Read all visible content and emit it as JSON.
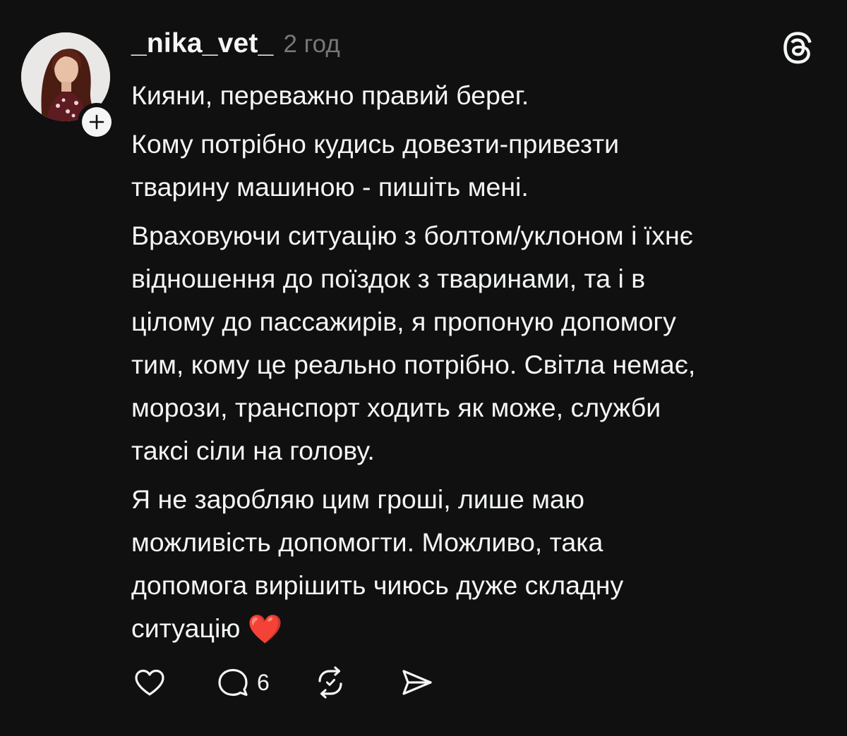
{
  "post": {
    "username": "_nika_vet_",
    "timestamp": "2 год",
    "paragraphs": [
      "Кияни, переважно правий берег.",
      "Кому потрібно кудись довезти-привезти\nтварину машиною - пишіть мені.",
      "Враховуючи ситуацію з болтом/уклоном і їхнє\nвідношення до поїздок з тваринами, та і в\nцілому до пассажирів, я пропоную допомогу\nтим, кому це реально потрібно. Світла немає,\nморози, транспорт ходить як може, служби\nтаксі сіли на голову.",
      "Я не заробляю цим гроші, лише маю\nможливість допомогти. Можливо, така\nдопомога вирішить чиюсь дуже складну\nситуацію"
    ],
    "emoji": "❤️",
    "reply_count": "6"
  },
  "icons": {
    "follow": "plus-icon",
    "app_logo": "threads-logo-icon",
    "like": "heart-icon",
    "reply": "comment-bubble-icon",
    "repost": "repost-icon",
    "share": "send-icon"
  },
  "colors": {
    "background": "#101010",
    "text": "#f3f5f7",
    "secondary_text": "#777777",
    "heart_emoji": "#e0242f"
  }
}
